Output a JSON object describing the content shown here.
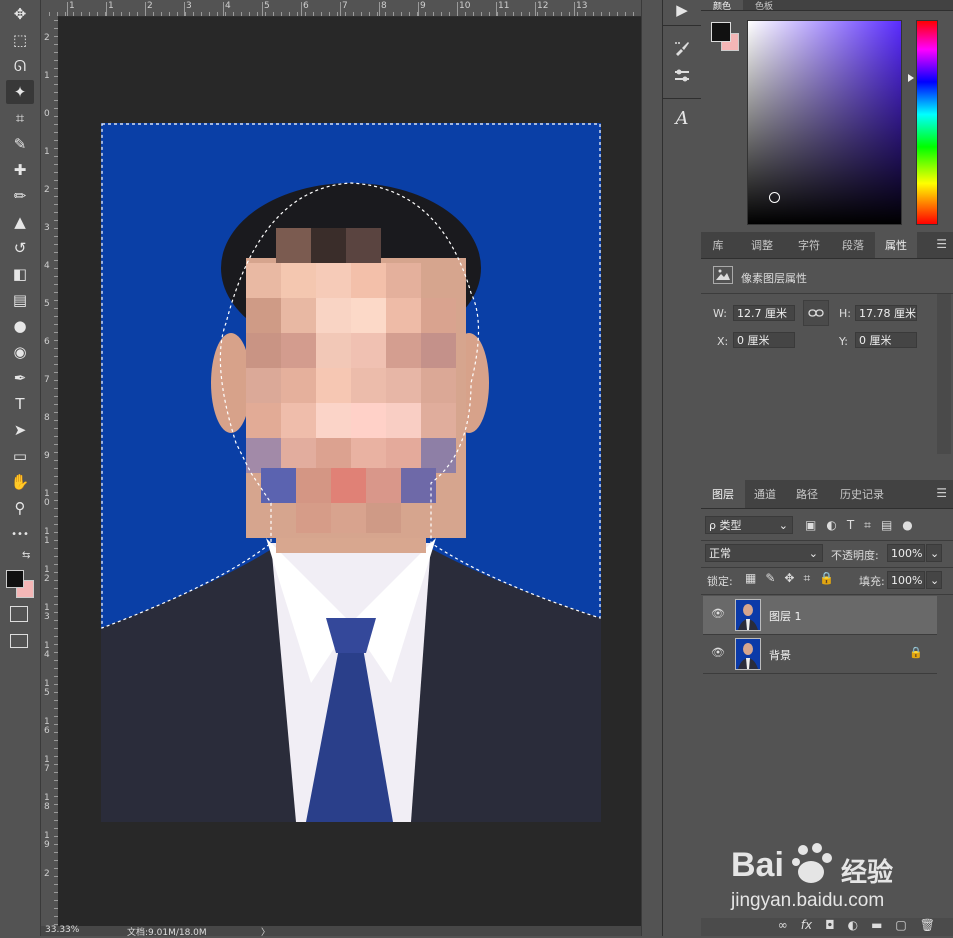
{
  "toolbar": {
    "tools": [
      {
        "name": "move-tool",
        "icon": "✥"
      },
      {
        "name": "marquee-tool",
        "icon": "⬚"
      },
      {
        "name": "lasso-tool",
        "icon": "ᘏ"
      },
      {
        "name": "magic-wand-tool",
        "icon": "✦"
      },
      {
        "name": "crop-tool",
        "icon": "⌗"
      },
      {
        "name": "eyedropper-tool",
        "icon": "✎"
      },
      {
        "name": "healing-brush-tool",
        "icon": "✚"
      },
      {
        "name": "brush-tool",
        "icon": "✏"
      },
      {
        "name": "clone-stamp-tool",
        "icon": "▲"
      },
      {
        "name": "history-brush-tool",
        "icon": "↺"
      },
      {
        "name": "eraser-tool",
        "icon": "◧"
      },
      {
        "name": "gradient-tool",
        "icon": "▤"
      },
      {
        "name": "blur-tool",
        "icon": "●"
      },
      {
        "name": "dodge-tool",
        "icon": "◉"
      },
      {
        "name": "pen-tool",
        "icon": "✒"
      },
      {
        "name": "type-tool",
        "icon": "T"
      },
      {
        "name": "path-selection-tool",
        "icon": "➤"
      },
      {
        "name": "rectangle-tool",
        "icon": "▭"
      },
      {
        "name": "hand-tool",
        "icon": "✋"
      },
      {
        "name": "zoom-tool",
        "icon": "⚲"
      },
      {
        "name": "more-tools",
        "icon": "•••"
      }
    ]
  },
  "ruler": {
    "h_labels": [
      "1",
      "1",
      "2",
      "3",
      "4",
      "5",
      "6",
      "7",
      "8",
      "9",
      "10",
      "11",
      "12",
      "13"
    ],
    "v_labels": [
      "2",
      "1",
      "0",
      "1",
      "2",
      "3",
      "4",
      "5",
      "6",
      "7",
      "8",
      "9",
      "1\n0",
      "1\n1",
      "1\n2",
      "1\n3",
      "1\n4",
      "1\n5",
      "1\n6",
      "1\n7",
      "1\n8",
      "1\n9",
      "2"
    ]
  },
  "status": {
    "zoom": "33.33%",
    "doc_info": "文档:9.01M/18.0M",
    "arrow": "〉"
  },
  "midpanel": {
    "play": "▶",
    "brush": "🖌",
    "sliders": "☰",
    "glyph": "A"
  },
  "color_panel": {
    "tab1": "颜色",
    "tab2": "色板",
    "fg": "#111111",
    "bg": "#f4b6b6"
  },
  "properties_panel": {
    "tabs": [
      "库",
      "调整",
      "字符",
      "段落",
      "属性"
    ],
    "active_tab": "属性",
    "title": "像素图层属性",
    "w_label": "W:",
    "w_value": "12.7 厘米",
    "h_label": "H:",
    "h_value": "17.78 厘米",
    "x_label": "X:",
    "x_value": "0 厘米",
    "y_label": "Y:",
    "y_value": "0 厘米"
  },
  "layers_panel": {
    "tabs": [
      "图层",
      "通道",
      "路径",
      "历史记录"
    ],
    "active_tab": "图层",
    "filter_kind": "ρ 类型",
    "blend_mode": "正常",
    "opacity_label": "不透明度:",
    "opacity_value": "100%",
    "lock_label": "锁定:",
    "fill_label": "填充:",
    "fill_value": "100%",
    "layers": [
      {
        "name": "图层 1",
        "selected": true,
        "locked": false
      },
      {
        "name": "背景",
        "selected": false,
        "locked": true
      }
    ],
    "bottom_icons": [
      "∞",
      "fx",
      "◘",
      "◐",
      "▬",
      "▢",
      "🗑"
    ]
  },
  "watermark": {
    "brand": "Bai",
    "brand2": "经验",
    "url": "jingyan.baidu.com"
  }
}
